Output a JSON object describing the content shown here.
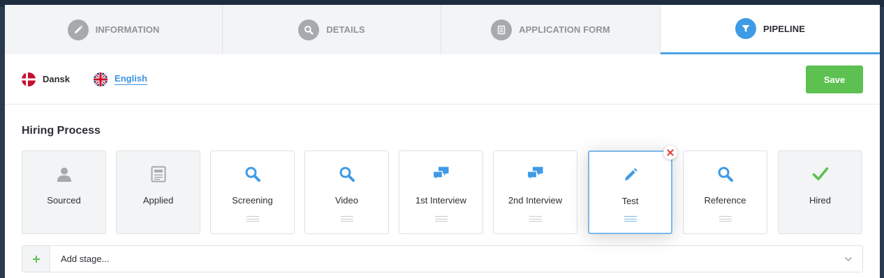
{
  "tabs": [
    {
      "label": "INFORMATION",
      "icon": "pencil-icon",
      "active": false
    },
    {
      "label": "DETAILS",
      "icon": "search-icon",
      "active": false
    },
    {
      "label": "APPLICATION FORM",
      "icon": "form-icon",
      "active": false
    },
    {
      "label": "PIPELINE",
      "icon": "funnel-icon",
      "active": true
    }
  ],
  "languages": [
    {
      "label": "Dansk",
      "flag": "denmark-flag-icon",
      "active": false
    },
    {
      "label": "English",
      "flag": "uk-flag-icon",
      "active": true
    }
  ],
  "save_label": "Save",
  "hiring_process": {
    "title": "Hiring Process",
    "stages": [
      {
        "label": "Sourced",
        "icon": "person-icon",
        "fixed": true
      },
      {
        "label": "Applied",
        "icon": "document-icon",
        "fixed": true
      },
      {
        "label": "Screening",
        "icon": "search-icon",
        "fixed": false
      },
      {
        "label": "Video",
        "icon": "search-icon",
        "fixed": false
      },
      {
        "label": "1st Interview",
        "icon": "chat-bubbles-icon",
        "fixed": false
      },
      {
        "label": "2nd Interview",
        "icon": "chat-bubbles-icon",
        "fixed": false
      },
      {
        "label": "Test",
        "icon": "pencil-icon",
        "fixed": false,
        "selected": true
      },
      {
        "label": "Reference",
        "icon": "search-icon",
        "fixed": false
      },
      {
        "label": "Hired",
        "icon": "checkmark-icon",
        "fixed": true
      }
    ]
  },
  "add_stage": {
    "placeholder": "Add stage..."
  },
  "colors": {
    "accent": "#3f9be6",
    "save": "#5cc151",
    "remove": "#e0413e",
    "check": "#5cc151",
    "inactive_icon": "#a6a9ad"
  }
}
